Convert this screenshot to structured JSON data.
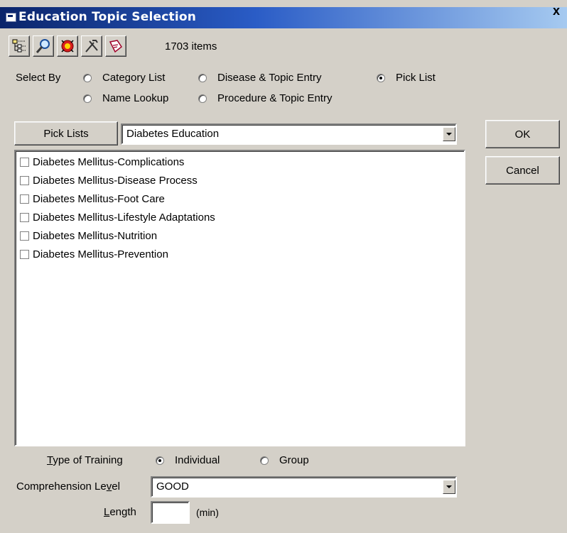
{
  "window": {
    "title": "Education Topic Selection",
    "close_label": "x"
  },
  "toolbar": {
    "buttons": [
      "tree-icon",
      "search-icon",
      "bug-icon",
      "tools-icon",
      "tag-icon"
    ],
    "items_count": "1703 items"
  },
  "select_by": {
    "label": "Select By",
    "options": [
      {
        "label": "Category List",
        "checked": false
      },
      {
        "label": "Disease & Topic Entry",
        "checked": false
      },
      {
        "label": "Pick List",
        "checked": true
      },
      {
        "label": "Name Lookup",
        "checked": false
      },
      {
        "label": "Procedure & Topic Entry",
        "checked": false
      }
    ]
  },
  "pick_lists": {
    "button_label": "Pick Lists",
    "selected": "Diabetes Education"
  },
  "topics": [
    {
      "label": "Diabetes Mellitus-Complications",
      "checked": false
    },
    {
      "label": "Diabetes Mellitus-Disease Process",
      "checked": false
    },
    {
      "label": "Diabetes Mellitus-Foot Care",
      "checked": false
    },
    {
      "label": "Diabetes Mellitus-Lifestyle Adaptations",
      "checked": false
    },
    {
      "label": "Diabetes Mellitus-Nutrition",
      "checked": false
    },
    {
      "label": "Diabetes Mellitus-Prevention",
      "checked": false
    }
  ],
  "actions": {
    "ok_label": "OK",
    "cancel_label": "Cancel"
  },
  "training": {
    "label_pre": "",
    "label_accel": "T",
    "label_post": "ype of Training",
    "options": [
      {
        "label": "Individual",
        "checked": true
      },
      {
        "label": "Group",
        "checked": false
      }
    ]
  },
  "comprehension": {
    "label_pre": "Comprehension Le",
    "label_accel": "v",
    "label_post": "el",
    "value": "GOOD"
  },
  "length": {
    "label_pre": "",
    "label_accel": "L",
    "label_post": "ength",
    "value": "",
    "unit": "(min)"
  }
}
